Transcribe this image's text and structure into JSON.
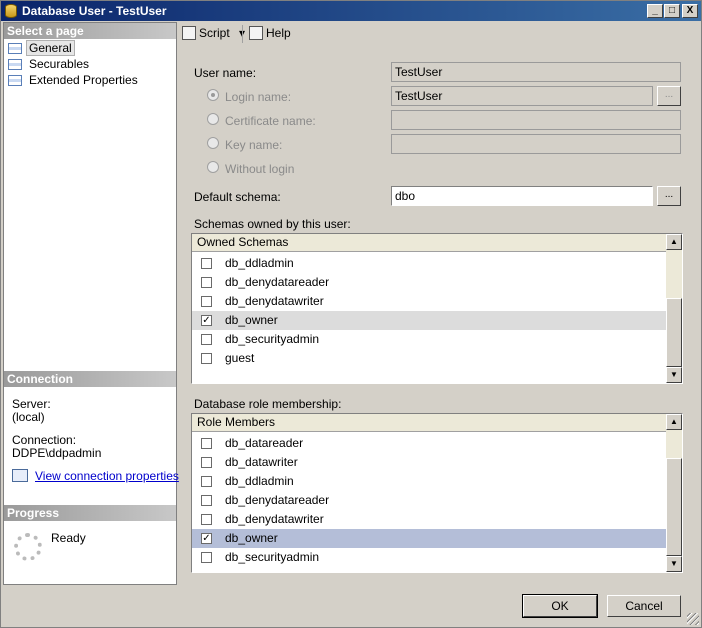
{
  "window": {
    "title": "Database User - TestUser",
    "minimize": "_",
    "maximize": "□",
    "close": "X"
  },
  "sidebar": {
    "select_page_header": "Select a page",
    "pages": [
      {
        "label": "General",
        "selected": true
      },
      {
        "label": "Securables"
      },
      {
        "label": "Extended Properties"
      }
    ],
    "connection_header": "Connection",
    "server_label": "Server:",
    "server_value": "(local)",
    "connection_label": "Connection:",
    "connection_value": "DDPE\\ddpadmin",
    "view_connection_link": "View connection properties",
    "progress_header": "Progress",
    "progress_status": "Ready"
  },
  "toolbar": {
    "script_label": "Script",
    "dropdown_arrow": "▾",
    "help_label": "Help"
  },
  "form": {
    "user_name_label": "User name:",
    "user_name_value": "TestUser",
    "login_name_label": "Login name:",
    "login_name_value": "TestUser",
    "certificate_name_label": "Certificate name:",
    "key_name_label": "Key name:",
    "without_login_label": "Without login",
    "default_schema_label": "Default schema:",
    "default_schema_value": "dbo",
    "browse_label": "...",
    "schemas_owned_label": "Schemas owned by this user:",
    "role_membership_label": "Database role membership:"
  },
  "owned_schemas": {
    "header": "Owned Schemas",
    "rows": [
      {
        "label": "db_ddladmin",
        "checked": ""
      },
      {
        "label": "db_denydatareader",
        "checked": ""
      },
      {
        "label": "db_denydatawriter",
        "checked": ""
      },
      {
        "label": "db_owner",
        "checked": "✓"
      },
      {
        "label": "db_securityadmin",
        "checked": ""
      },
      {
        "label": "guest",
        "checked": ""
      }
    ]
  },
  "role_members": {
    "header": "Role Members",
    "rows": [
      {
        "label": "db_datareader",
        "checked": ""
      },
      {
        "label": "db_datawriter",
        "checked": ""
      },
      {
        "label": "db_ddladmin",
        "checked": ""
      },
      {
        "label": "db_denydatareader",
        "checked": ""
      },
      {
        "label": "db_denydatawriter",
        "checked": ""
      },
      {
        "label": "db_owner",
        "checked": "✓"
      },
      {
        "label": "db_securityadmin",
        "checked": ""
      }
    ]
  },
  "scroll": {
    "up_arrow": "▲",
    "down_arrow": "▼"
  },
  "buttons": {
    "ok_label": "OK",
    "cancel_label": "Cancel"
  }
}
